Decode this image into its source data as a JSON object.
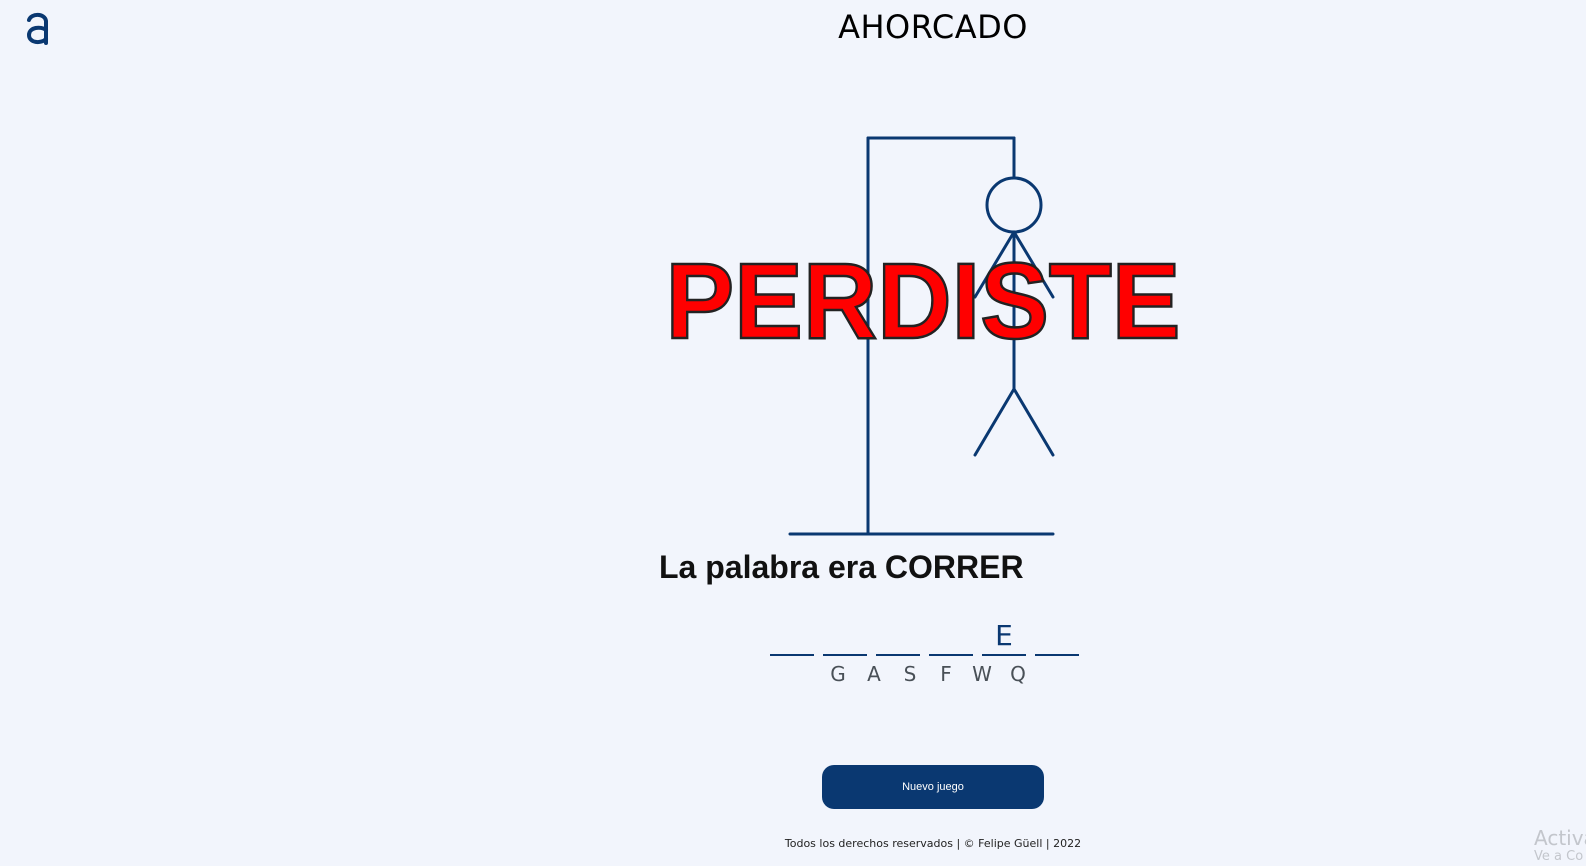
{
  "header": {
    "logo_icon": "alura-a-logo-icon",
    "title": "AHORCADO"
  },
  "game": {
    "result_banner": "PERDISTE",
    "result_color": "#ff0000",
    "word_reveal": "La palabra era CORRER",
    "word_slots": [
      "",
      "",
      "",
      "",
      "E",
      ""
    ],
    "wrong_letters": [
      "G",
      "A",
      "S",
      "F",
      "W",
      "Q"
    ],
    "hangman_color": "#0a3871",
    "hangman_parts_shown": 6
  },
  "actions": {
    "new_game_label": "Nuevo juego",
    "button_color": "#0a3871"
  },
  "footer": {
    "text": "Todos los derechos reservados | © Felipe Güell | 2022"
  },
  "watermark": {
    "line1": "Activa",
    "line2": "Ve a Co"
  }
}
